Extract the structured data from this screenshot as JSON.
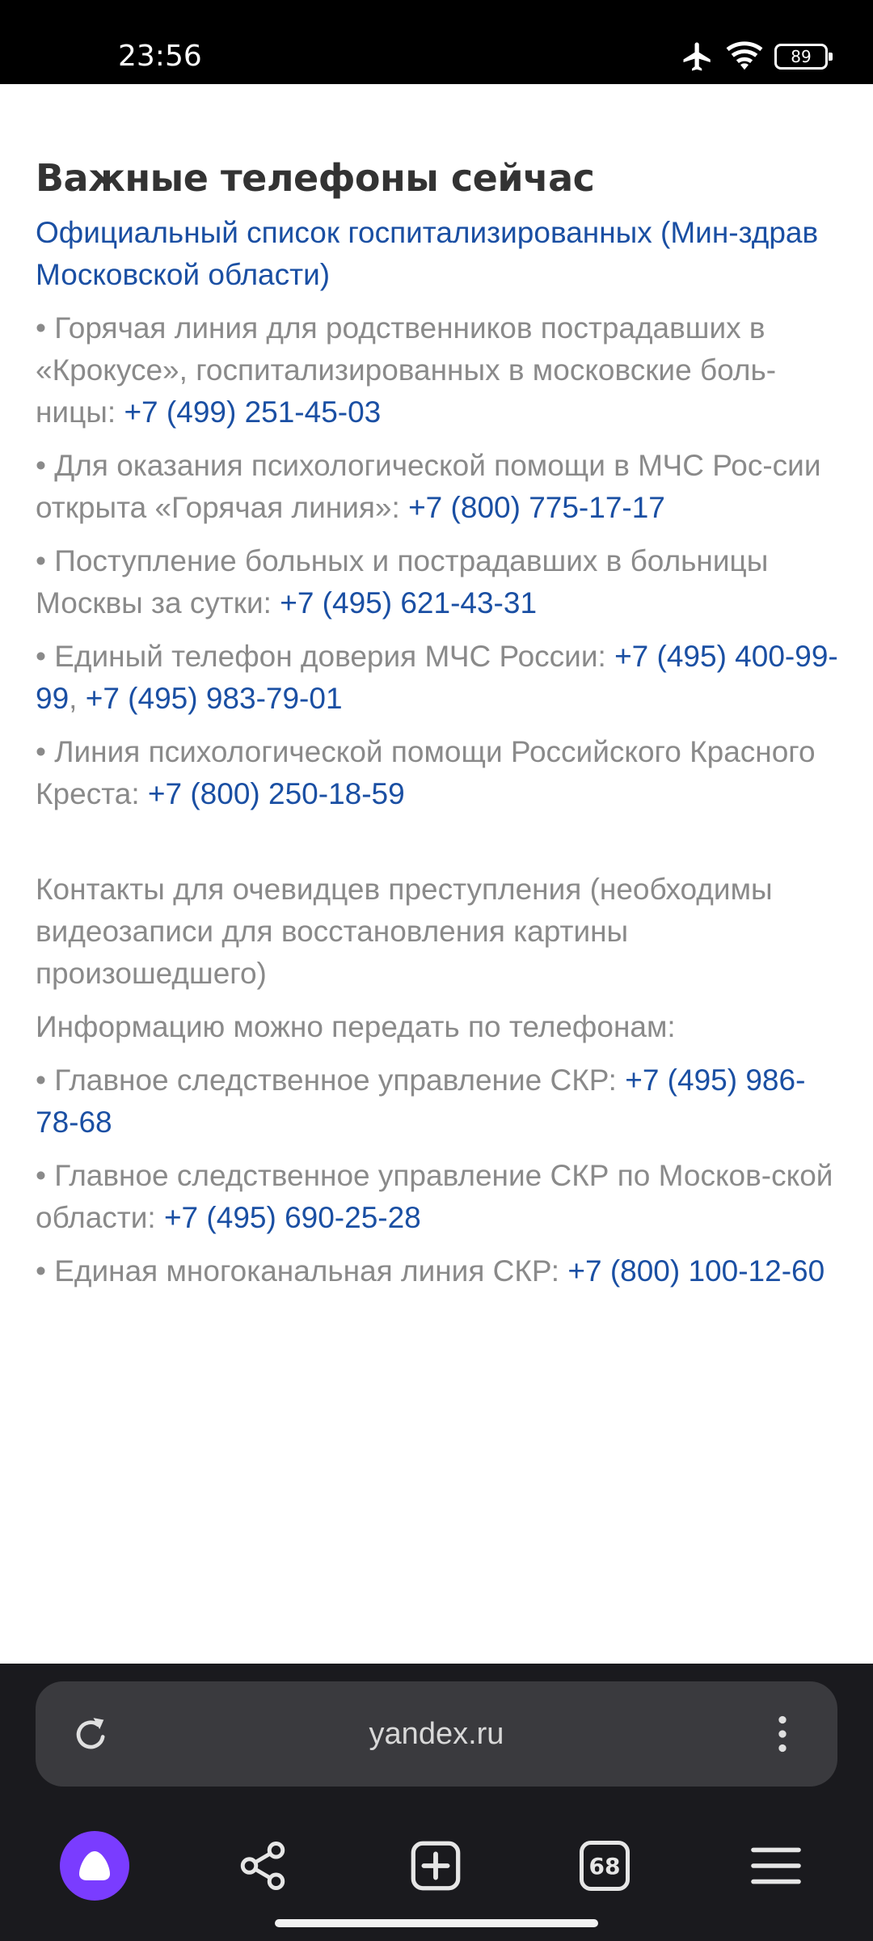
{
  "status_bar": {
    "time": "23:56",
    "battery": "89",
    "icons": [
      "airplane-icon",
      "wifi-icon",
      "battery-icon"
    ]
  },
  "article": {
    "heading": "Важные телефоны сейчас",
    "official_link": "Официальный список госпитализированных (Мин-здрав Московской области)",
    "items": [
      {
        "text": "• Горячая линия для родственников пострадавших в «Крокусе», госпитализированных в московские боль-ницы: ",
        "phones": [
          "+7 (499) 251-45-03"
        ]
      },
      {
        "text": "• Для оказания психологической помощи в МЧС Рос-сии открыта «Горячая линия»: ",
        "phones": [
          "+7 (800) 775-17-17"
        ]
      },
      {
        "text": "• Поступление больных и пострадавших в больницы Москвы за сутки: ",
        "phones": [
          "+7 (495) 621-43-31"
        ]
      },
      {
        "text": "• Единый телефон доверия МЧС России: ",
        "phones": [
          "+7 (495) 400-99-99",
          "+7 (495) 983-79-01"
        ],
        "separator": ", "
      },
      {
        "text": "• Линия психологической помощи Российского Красного Креста: ",
        "phones": [
          "+7 (800) 250-18-59"
        ]
      }
    ],
    "witness_intro": "Контакты для очевидцев преступления (необходимы видеозаписи для восстановления картины произошедшего)",
    "witness_prompt": "Информацию можно передать по телефонам:",
    "witness_items": [
      {
        "text": "• Главное следственное управление СКР: ",
        "phones": [
          "+7 (495) 986-78-68"
        ]
      },
      {
        "text": "• Главное следственное управление СКР по Москов-ской области: ",
        "phones": [
          "+7 (495) 690-25-28"
        ]
      },
      {
        "text": "• Единая многоканальная линия СКР: ",
        "phones": [
          "+7 (800) 100-12-60"
        ]
      }
    ]
  },
  "browser": {
    "url": "yandex.ru",
    "tabs_count": "68",
    "nav_icons": [
      "alice-icon",
      "share-icon",
      "new-tab-icon",
      "tabs-icon",
      "menu-icon"
    ]
  },
  "colors": {
    "link": "#1a4fa3",
    "text": "#8a8a8a",
    "heading": "#333333",
    "alice": "#7a3cff"
  }
}
